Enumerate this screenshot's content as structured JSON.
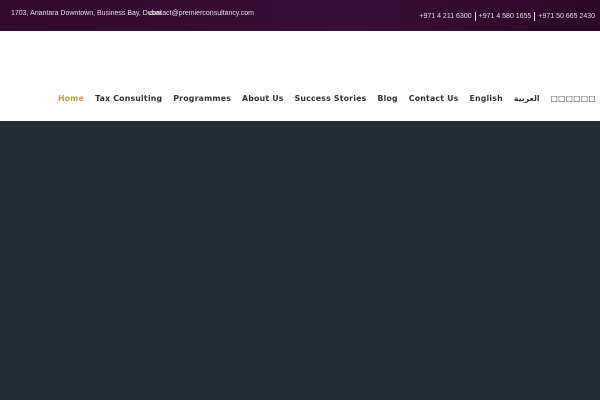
{
  "topbar": {
    "address": "1703, Anantara Downtown, Business Bay, Dubai",
    "email": "contact@premierconsultancy.com",
    "phones": [
      "+971 4 211 6300",
      "+971 4 580 1655",
      "+971 50 665 2430"
    ]
  },
  "nav": {
    "items": [
      {
        "label": "Home",
        "active": true
      },
      {
        "label": "Tax Consulting"
      },
      {
        "label": "Programmes"
      },
      {
        "label": "About Us"
      },
      {
        "label": "Success Stories"
      },
      {
        "label": "Blog"
      },
      {
        "label": "Contact Us"
      },
      {
        "label": "English"
      },
      {
        "label": "العربية"
      },
      {
        "label": "□□□□□□"
      }
    ]
  },
  "colors": {
    "topbar_bg": "#330b30",
    "nav_active": "#c49a3c",
    "nav_text": "#333333",
    "hero_bg": "#242e37"
  }
}
